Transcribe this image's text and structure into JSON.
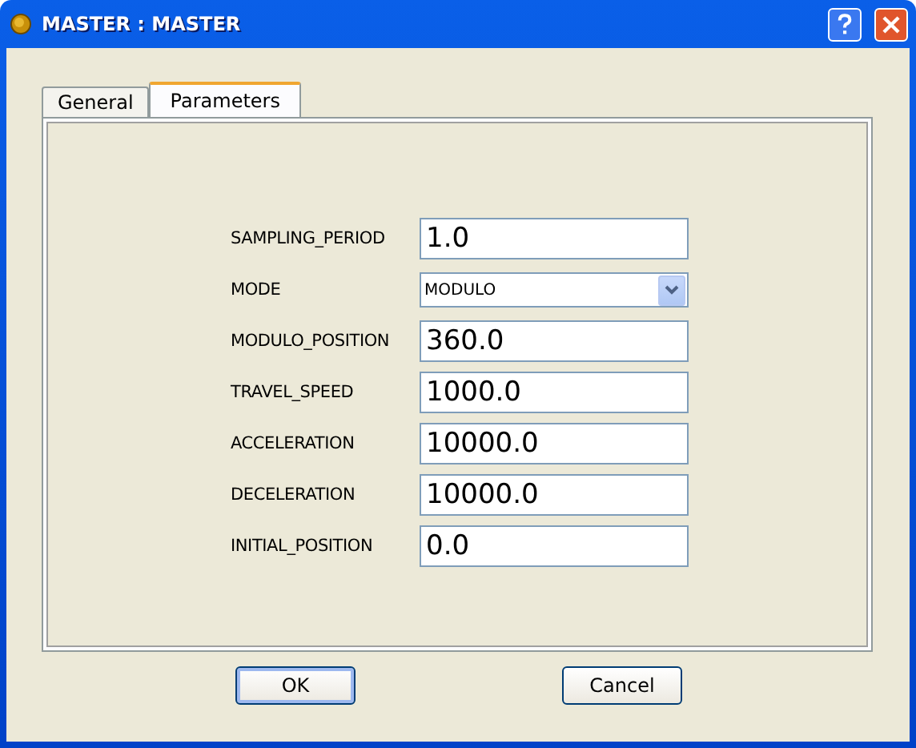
{
  "window": {
    "title": "MASTER : MASTER"
  },
  "tabs": [
    {
      "label": "General",
      "selected": false
    },
    {
      "label": "Parameters",
      "selected": true
    }
  ],
  "fields": [
    {
      "kind": "text",
      "label": "SAMPLING_PERIOD",
      "value": "1.0"
    },
    {
      "kind": "dropdown",
      "label": "MODE",
      "value": "MODULO"
    },
    {
      "kind": "text",
      "label": "MODULO_POSITION",
      "value": "360.0"
    },
    {
      "kind": "text",
      "label": "TRAVEL_SPEED",
      "value": "1000.0"
    },
    {
      "kind": "text",
      "label": "ACCELERATION",
      "value": "10000.0"
    },
    {
      "kind": "text",
      "label": "DECELERATION",
      "value": "10000.0"
    },
    {
      "kind": "text",
      "label": "INITIAL_POSITION",
      "value": "0.0"
    }
  ],
  "buttons": [
    {
      "label": "OK",
      "default": true
    },
    {
      "label": "Cancel",
      "default": false
    }
  ]
}
